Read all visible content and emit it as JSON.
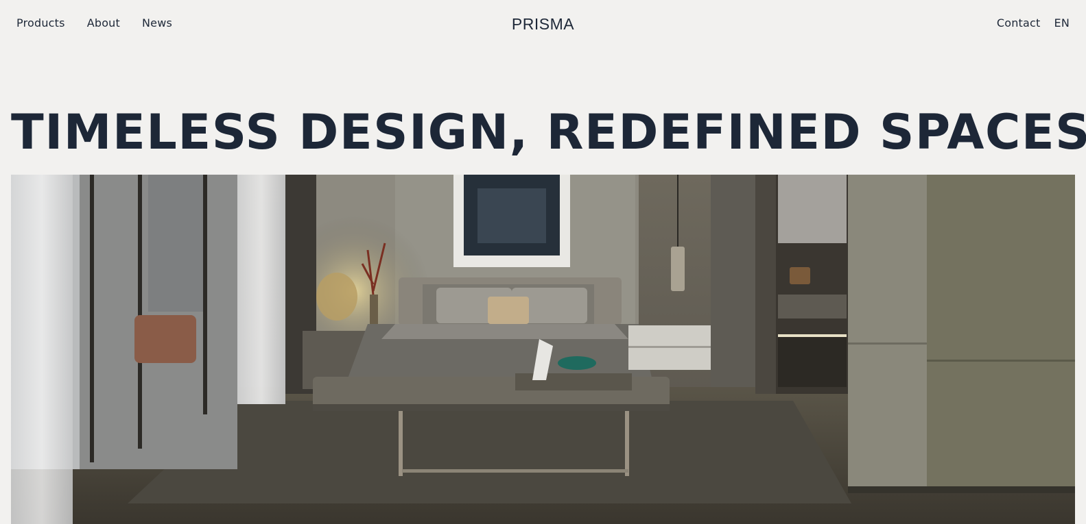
{
  "nav": {
    "left": [
      "Products",
      "About",
      "News"
    ],
    "brand": "PRISMA",
    "contact": "Contact",
    "language": "EN"
  },
  "hero": {
    "headline": "TIMELESS DESIGN, REDEFINED SPACES.",
    "image_description_icon": "bedroom-photo"
  },
  "colors": {
    "background": "#f2f1ef",
    "text": "#1e2838"
  }
}
